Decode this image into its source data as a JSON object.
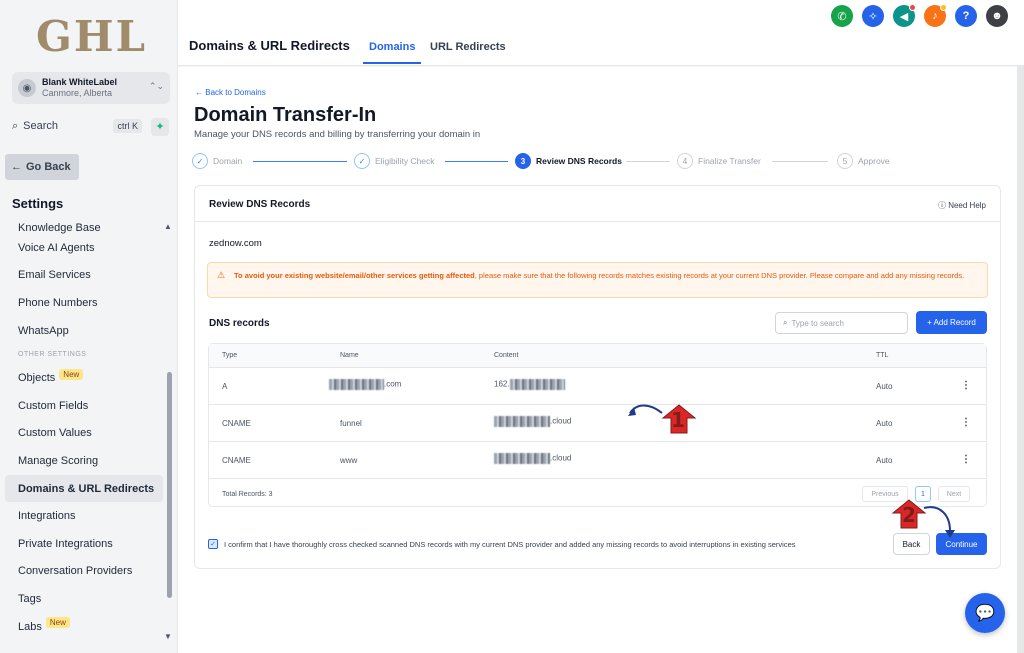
{
  "sidebar": {
    "logo": "GHL",
    "account": {
      "name": "Blank WhiteLabel",
      "location": "Canmore, Alberta"
    },
    "search": {
      "label": "Search",
      "shortcut": "ctrl K"
    },
    "go_back": "Go Back",
    "settings_heading": "Settings",
    "items_top": [
      {
        "label": "Knowledge Base"
      },
      {
        "label": "Voice AI Agents"
      },
      {
        "label": "Email Services"
      },
      {
        "label": "Phone Numbers"
      },
      {
        "label": "WhatsApp"
      }
    ],
    "section_label": "OTHER SETTINGS",
    "items_bottom": [
      {
        "label": "Objects",
        "badge": "New"
      },
      {
        "label": "Custom Fields"
      },
      {
        "label": "Custom Values"
      },
      {
        "label": "Manage Scoring"
      },
      {
        "label": "Domains & URL Redirects",
        "active": true
      },
      {
        "label": "Integrations"
      },
      {
        "label": "Private Integrations"
      },
      {
        "label": "Conversation Providers"
      },
      {
        "label": "Tags"
      },
      {
        "label": "Labs",
        "badge": "New"
      }
    ]
  },
  "header": {
    "title": "Domains & URL Redirects",
    "tabs": [
      {
        "label": "Domains",
        "active": true
      },
      {
        "label": "URL Redirects"
      }
    ],
    "icons": [
      {
        "name": "phone-icon",
        "color": "#16a34a"
      },
      {
        "name": "sparkle-icon",
        "color": "#2563eb"
      },
      {
        "name": "megaphone-icon",
        "color": "#0d9488"
      },
      {
        "name": "bell-icon",
        "color": "#f97316"
      },
      {
        "name": "help-icon",
        "color": "#2563eb"
      }
    ]
  },
  "main": {
    "back_link": "Back to Domains",
    "title": "Domain Transfer-In",
    "subtitle": "Manage your DNS records and billing by transferring your domain in",
    "steps": [
      {
        "num": "✓",
        "label": "Domain"
      },
      {
        "num": "✓",
        "label": "Eligibility Check"
      },
      {
        "num": "3",
        "label": "Review DNS Records"
      },
      {
        "num": "4",
        "label": "Finalize Transfer"
      },
      {
        "num": "5",
        "label": "Approve"
      }
    ],
    "card_title": "Review DNS Records",
    "need_help": "Need Help",
    "domain": "zednow.com",
    "warning_bold": "To avoid your existing website/email/other services getting affected",
    "warning_rest": ", please make sure that the following records matches existing records at your current DNS provider. Please compare and add any missing records.",
    "dns_heading": "DNS records",
    "search_placeholder": "Type to search",
    "add_record": "+ Add Record",
    "columns": {
      "type": "Type",
      "name": "Name",
      "content": "Content",
      "ttl": "TTL"
    },
    "rows": [
      {
        "type": "A",
        "name_suffix": ".com",
        "content_prefix": "162.",
        "content_suffix": "",
        "ttl": "Auto"
      },
      {
        "type": "CNAME",
        "name": "funnel",
        "content_suffix": ".cloud",
        "ttl": "Auto"
      },
      {
        "type": "CNAME",
        "name": "www",
        "content_suffix": ".cloud",
        "ttl": "Auto"
      }
    ],
    "total_records": "Total Records: 3",
    "pagination": {
      "prev": "Previous",
      "page": "1",
      "next": "Next"
    },
    "confirm_text": "I confirm that I have thoroughly cross checked scanned DNS records with my current DNS provider and added any missing records to avoid interruptions in existing services",
    "back_button": "Back",
    "continue_button": "Continue"
  },
  "annotations": {
    "one": "1",
    "two": "2"
  },
  "colors": {
    "accent": "#2563eb",
    "warning_text": "#ea580c",
    "annotation": "#dc2626"
  }
}
